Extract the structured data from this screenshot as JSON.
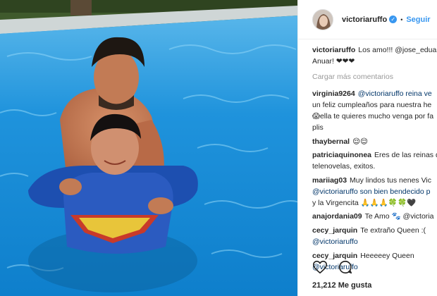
{
  "post": {
    "username": "victoriaruffo",
    "verified_badge": "✓",
    "separator": "•",
    "follow_label": "Seguir",
    "caption": {
      "user": "victoriaruffo",
      "line1": "Los amo!!! @jose_eduardo",
      "line2": "Anuar! ❤❤❤"
    },
    "load_more": "Cargar más comentarios",
    "comments": [
      {
        "user": "virginia9264",
        "lines": [
          "@victoriaruffo reina ve",
          "un feliz cumpleaños para nuestra he",
          "😱ella te quieres mucho venga por fa",
          "plis"
        ]
      },
      {
        "user": "thaybernal",
        "lines": [
          "😌😌"
        ]
      },
      {
        "user": "patriciaquinonea",
        "lines": [
          "Eres de las reinas d",
          "telenovelas, exitos."
        ]
      },
      {
        "user": "mariiag03",
        "lines": [
          "Muy lindos tus nenes Vic",
          "@victoriaruffo son bien bendecido p",
          "y la Virgencita 🙏🙏🙏🍀🍀🖤"
        ]
      },
      {
        "user": "anajordania09",
        "lines": [
          "Te Amo 🐾 @victoria"
        ]
      },
      {
        "user": "cecy_jarquin",
        "lines": [
          "Te extraño Queen :(",
          "@victoriaruffo"
        ]
      },
      {
        "user": "cecy_jarquin",
        "lines": [
          "Heeeeey Queen",
          "@victoriaruffo"
        ]
      }
    ],
    "like_icon": "heart-outline-icon",
    "comment_icon": "speech-bubble-icon",
    "likes": "21,212 Me gusta"
  },
  "colors": {
    "accent": "#3897f0",
    "mention": "#003569",
    "muted": "#999999"
  }
}
